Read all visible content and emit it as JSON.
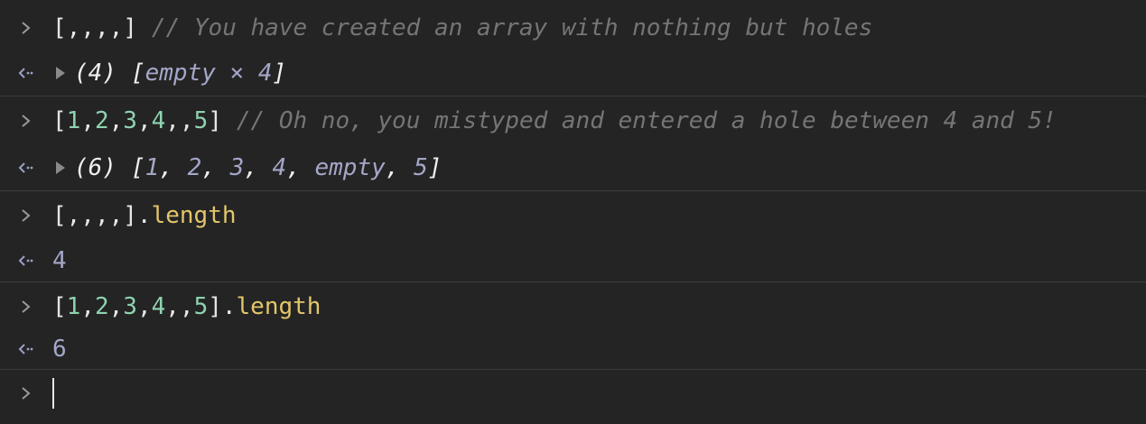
{
  "console": {
    "entries": [
      {
        "input": {
          "code": "[,,,,]",
          "comment": "// You have created an array with nothing but holes"
        },
        "output": {
          "count": "(4)",
          "open": "[",
          "body": "empty × 4",
          "close": "]"
        }
      },
      {
        "input": {
          "open": "[",
          "nums": [
            "1",
            "2",
            "3",
            "4",
            "5"
          ],
          "sep": ",",
          "holes": ",,",
          "close": "]",
          "comment": "// Oh no, you mistyped and entered a hole between 4 and 5!"
        },
        "output": {
          "count": "(6)",
          "open": "[",
          "items": [
            "1",
            "2",
            "3",
            "4",
            "empty",
            "5"
          ],
          "sep": ", ",
          "close": "]"
        }
      },
      {
        "input": {
          "code": "[,,,,]",
          "dot": ".",
          "prop": "length"
        },
        "output": {
          "value": "4"
        }
      },
      {
        "input": {
          "open": "[",
          "nums": [
            "1",
            "2",
            "3",
            "4",
            "5"
          ],
          "sep": ",",
          "holes": ",,",
          "close": "]",
          "dot": ".",
          "prop": "length"
        },
        "output": {
          "value": "6"
        }
      }
    ],
    "prompt_icon": "chevron-right-icon",
    "result_icon": "return-arrow-icon",
    "colors": {
      "background": "#242424",
      "number": "#8fd3b0",
      "property": "#e3c66a",
      "comment": "#757575",
      "result_number": "#a4a7c8"
    }
  }
}
